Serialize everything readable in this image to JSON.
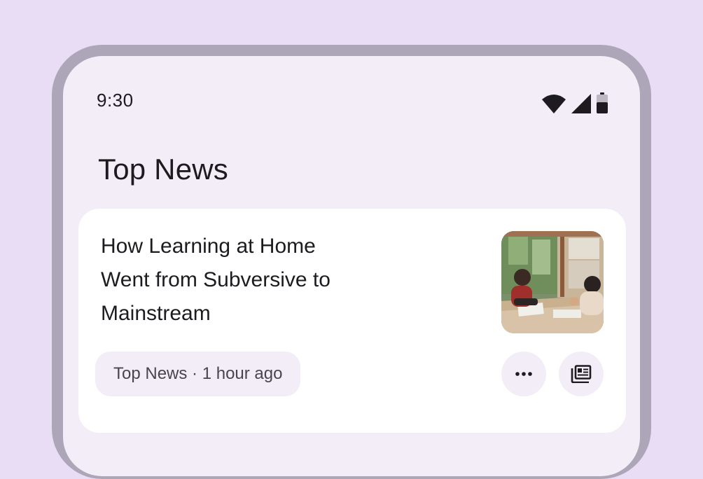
{
  "status_bar": {
    "time": "9:30",
    "icons": [
      "wifi-icon",
      "cellular-signal-icon",
      "battery-icon"
    ]
  },
  "page": {
    "title": "Top News"
  },
  "news_card": {
    "headline": "How Learning at Home Went from Subversive to Mainstream",
    "meta": "Top News · 1 hour ago",
    "thumbnail_icon": "people-studying-at-table-photo",
    "actions": [
      "more-options-icon",
      "newspaper-icon"
    ]
  },
  "colors": {
    "page_background": "#E8DDF4",
    "device_frame": "#ADA6B8",
    "screen_surface": "#F2EDF7",
    "card_surface": "#FFFFFF",
    "text_primary": "#1D1B20",
    "text_secondary": "#49454F"
  }
}
